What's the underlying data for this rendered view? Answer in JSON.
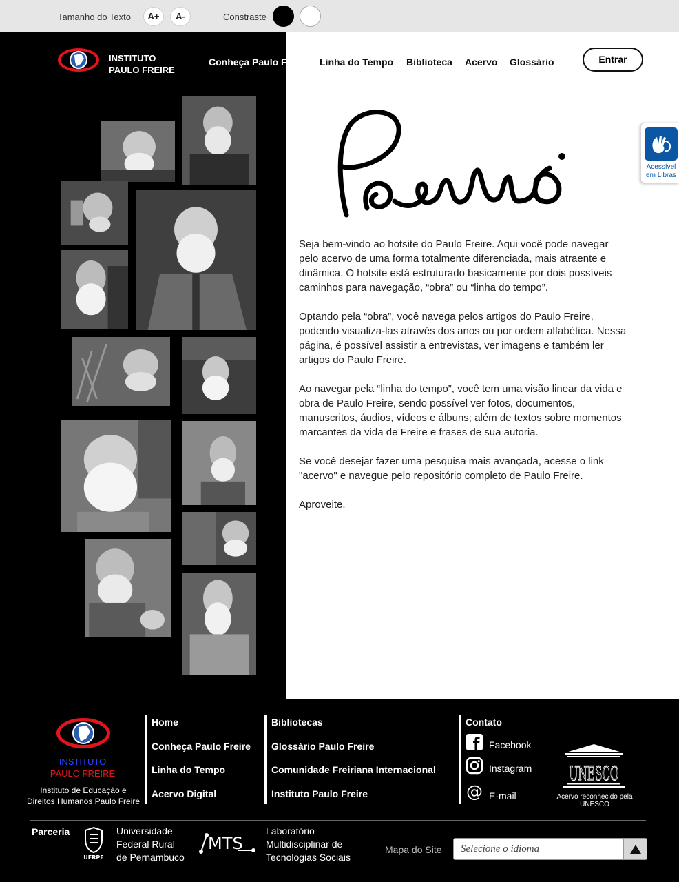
{
  "accessibility": {
    "text_size_label": "Tamanho do Texto",
    "increase_label": "A+",
    "decrease_label": "A-",
    "contrast_label": "Constraste"
  },
  "header": {
    "logo_line1": "INSTITUTO",
    "logo_line2": "PAULO FREIRE",
    "nav": [
      "Conheça Paulo Freire",
      "Linha do Tempo",
      "Biblioteca",
      "Acervo",
      "Glossário"
    ],
    "login_label": "Entrar"
  },
  "libras": {
    "label_line1": "Acessível",
    "label_line2": "em Libras"
  },
  "main": {
    "paragraphs": [
      "Seja bem-vindo ao hotsite do Paulo Freire. Aqui você pode navegar pelo acervo de uma forma totalmente diferenciada, mais atraente e dinâmica. O hotsite está estruturado basicamente por dois possíveis caminhos para navegação, “obra” ou “linha do tempo”.",
      "Optando pela “obra”, você navega pelos artigos do Paulo Freire, podendo visualiza-las através dos anos ou por ordem alfabética. Nessa página, é possível assistir a entrevistas, ver imagens e também ler artigos do Paulo Freire.",
      "Ao navegar pela “linha do tempo”, você tem uma visão linear da vida e obra de Paulo Freire, sendo possível ver fotos, documentos, manuscritos, áudios, vídeos e álbuns; além de textos sobre momentos marcantes da vida de Freire e frases de sua autoria.",
      "Se você desejar fazer uma pesquisa mais avançada, acesse o link \"acervo\" e navegue pelo repositório completo de Paulo Freire.",
      "Aproveite."
    ]
  },
  "footer": {
    "institute_line1": "INSTITUTO",
    "institute_line2": "PAULO FREIRE",
    "institute_desc_line1": "Instituto de Educação e",
    "institute_desc_line2": "Direitos Humanos Paulo Freire",
    "col1": [
      "Home",
      "Conheça Paulo Freire",
      "Linha do Tempo",
      "Acervo Digital"
    ],
    "col2": [
      "Bibliotecas",
      "Glossário Paulo Freire",
      "Comunidade Freiriana Internacional",
      "Instituto Paulo Freire"
    ],
    "contact_title": "Contato",
    "social": [
      "Facebook",
      "Instagram",
      "E-mail"
    ],
    "unesco_caption": "Acervo reconhecido pela UNESCO",
    "parceria_label": "Parceria",
    "ufrpe_caption": "UFRPE",
    "partner1_line1": "Universidade",
    "partner1_line2": "Federal Rural",
    "partner1_line3": "de Pernambuco",
    "partner2_line1": "Laboratório",
    "partner2_line2": "Multidisciplinar de",
    "partner2_line3": "Tecnologias Sociais",
    "sitemap_label": "Mapa do Site",
    "language_placeholder": "Selecione o idioma"
  },
  "colors": {
    "brand_red": "#e3141c",
    "brand_blue": "#2747ff",
    "libras_blue": "#0b57a4"
  }
}
